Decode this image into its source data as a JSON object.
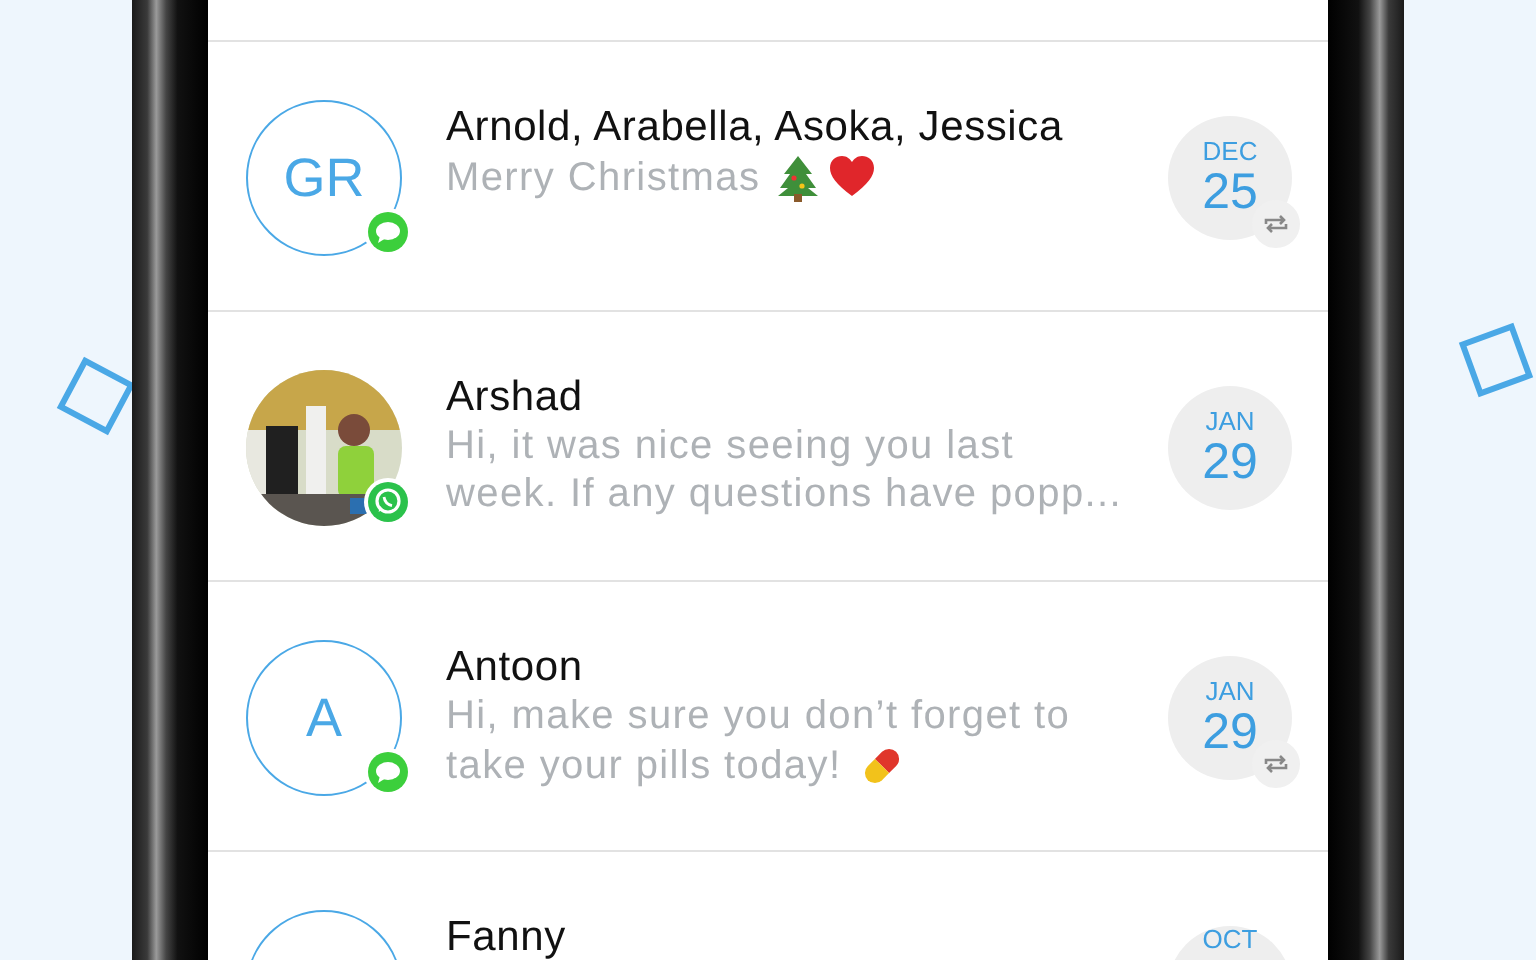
{
  "conversations": [
    {
      "name": "Arnold, Arabella, Asoka, Jessica",
      "message_lines": [
        "Merry Christmas"
      ],
      "emoji": [
        {
          "kind": "tree"
        },
        {
          "kind": "heart"
        }
      ],
      "avatar": {
        "kind": "initials",
        "initials": "GR"
      },
      "badge": {
        "kind": "bubble"
      },
      "date": {
        "month": "DEC",
        "day": "25"
      },
      "repeat": true
    },
    {
      "name": "Arshad",
      "message_lines": [
        "Hi, it was nice seeing you last",
        "week. If any questions have popp..."
      ],
      "badge": {
        "kind": "whatsapp"
      },
      "date": {
        "month": "JAN",
        "day": "29"
      },
      "repeat": false
    },
    {
      "name": "Antoon",
      "message_lines": [
        "Hi, make sure you don’t forget to",
        "take your pills today!"
      ],
      "emoji": [
        {
          "kind": "pill"
        }
      ],
      "avatar": {
        "kind": "initials",
        "initials": "A"
      },
      "badge": {
        "kind": "bubble"
      },
      "date": {
        "month": "JAN",
        "day": "29"
      },
      "repeat": true
    },
    {
      "name": "Fanny",
      "avatar": {
        "kind": "initials"
      },
      "date": {
        "month": "OCT"
      },
      "repeat": false
    }
  ]
}
